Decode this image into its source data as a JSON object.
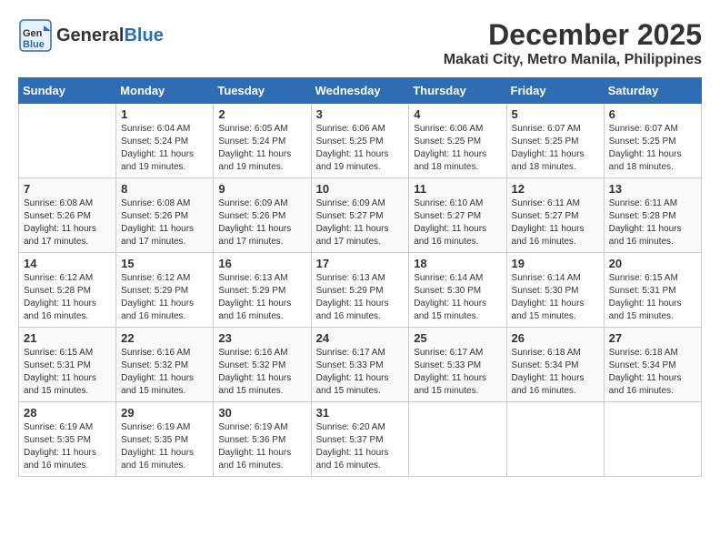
{
  "header": {
    "logo_general": "General",
    "logo_blue": "Blue",
    "month": "December 2025",
    "location": "Makati City, Metro Manila, Philippines"
  },
  "weekdays": [
    "Sunday",
    "Monday",
    "Tuesday",
    "Wednesday",
    "Thursday",
    "Friday",
    "Saturday"
  ],
  "weeks": [
    [
      {
        "day": "",
        "sunrise": "",
        "sunset": "",
        "daylight": ""
      },
      {
        "day": "1",
        "sunrise": "Sunrise: 6:04 AM",
        "sunset": "Sunset: 5:24 PM",
        "daylight": "Daylight: 11 hours and 19 minutes."
      },
      {
        "day": "2",
        "sunrise": "Sunrise: 6:05 AM",
        "sunset": "Sunset: 5:24 PM",
        "daylight": "Daylight: 11 hours and 19 minutes."
      },
      {
        "day": "3",
        "sunrise": "Sunrise: 6:06 AM",
        "sunset": "Sunset: 5:25 PM",
        "daylight": "Daylight: 11 hours and 19 minutes."
      },
      {
        "day": "4",
        "sunrise": "Sunrise: 6:06 AM",
        "sunset": "Sunset: 5:25 PM",
        "daylight": "Daylight: 11 hours and 18 minutes."
      },
      {
        "day": "5",
        "sunrise": "Sunrise: 6:07 AM",
        "sunset": "Sunset: 5:25 PM",
        "daylight": "Daylight: 11 hours and 18 minutes."
      },
      {
        "day": "6",
        "sunrise": "Sunrise: 6:07 AM",
        "sunset": "Sunset: 5:25 PM",
        "daylight": "Daylight: 11 hours and 18 minutes."
      }
    ],
    [
      {
        "day": "7",
        "sunrise": "Sunrise: 6:08 AM",
        "sunset": "Sunset: 5:26 PM",
        "daylight": "Daylight: 11 hours and 17 minutes."
      },
      {
        "day": "8",
        "sunrise": "Sunrise: 6:08 AM",
        "sunset": "Sunset: 5:26 PM",
        "daylight": "Daylight: 11 hours and 17 minutes."
      },
      {
        "day": "9",
        "sunrise": "Sunrise: 6:09 AM",
        "sunset": "Sunset: 5:26 PM",
        "daylight": "Daylight: 11 hours and 17 minutes."
      },
      {
        "day": "10",
        "sunrise": "Sunrise: 6:09 AM",
        "sunset": "Sunset: 5:27 PM",
        "daylight": "Daylight: 11 hours and 17 minutes."
      },
      {
        "day": "11",
        "sunrise": "Sunrise: 6:10 AM",
        "sunset": "Sunset: 5:27 PM",
        "daylight": "Daylight: 11 hours and 16 minutes."
      },
      {
        "day": "12",
        "sunrise": "Sunrise: 6:11 AM",
        "sunset": "Sunset: 5:27 PM",
        "daylight": "Daylight: 11 hours and 16 minutes."
      },
      {
        "day": "13",
        "sunrise": "Sunrise: 6:11 AM",
        "sunset": "Sunset: 5:28 PM",
        "daylight": "Daylight: 11 hours and 16 minutes."
      }
    ],
    [
      {
        "day": "14",
        "sunrise": "Sunrise: 6:12 AM",
        "sunset": "Sunset: 5:28 PM",
        "daylight": "Daylight: 11 hours and 16 minutes."
      },
      {
        "day": "15",
        "sunrise": "Sunrise: 6:12 AM",
        "sunset": "Sunset: 5:29 PM",
        "daylight": "Daylight: 11 hours and 16 minutes."
      },
      {
        "day": "16",
        "sunrise": "Sunrise: 6:13 AM",
        "sunset": "Sunset: 5:29 PM",
        "daylight": "Daylight: 11 hours and 16 minutes."
      },
      {
        "day": "17",
        "sunrise": "Sunrise: 6:13 AM",
        "sunset": "Sunset: 5:29 PM",
        "daylight": "Daylight: 11 hours and 16 minutes."
      },
      {
        "day": "18",
        "sunrise": "Sunrise: 6:14 AM",
        "sunset": "Sunset: 5:30 PM",
        "daylight": "Daylight: 11 hours and 15 minutes."
      },
      {
        "day": "19",
        "sunrise": "Sunrise: 6:14 AM",
        "sunset": "Sunset: 5:30 PM",
        "daylight": "Daylight: 11 hours and 15 minutes."
      },
      {
        "day": "20",
        "sunrise": "Sunrise: 6:15 AM",
        "sunset": "Sunset: 5:31 PM",
        "daylight": "Daylight: 11 hours and 15 minutes."
      }
    ],
    [
      {
        "day": "21",
        "sunrise": "Sunrise: 6:15 AM",
        "sunset": "Sunset: 5:31 PM",
        "daylight": "Daylight: 11 hours and 15 minutes."
      },
      {
        "day": "22",
        "sunrise": "Sunrise: 6:16 AM",
        "sunset": "Sunset: 5:32 PM",
        "daylight": "Daylight: 11 hours and 15 minutes."
      },
      {
        "day": "23",
        "sunrise": "Sunrise: 6:16 AM",
        "sunset": "Sunset: 5:32 PM",
        "daylight": "Daylight: 11 hours and 15 minutes."
      },
      {
        "day": "24",
        "sunrise": "Sunrise: 6:17 AM",
        "sunset": "Sunset: 5:33 PM",
        "daylight": "Daylight: 11 hours and 15 minutes."
      },
      {
        "day": "25",
        "sunrise": "Sunrise: 6:17 AM",
        "sunset": "Sunset: 5:33 PM",
        "daylight": "Daylight: 11 hours and 15 minutes."
      },
      {
        "day": "26",
        "sunrise": "Sunrise: 6:18 AM",
        "sunset": "Sunset: 5:34 PM",
        "daylight": "Daylight: 11 hours and 16 minutes."
      },
      {
        "day": "27",
        "sunrise": "Sunrise: 6:18 AM",
        "sunset": "Sunset: 5:34 PM",
        "daylight": "Daylight: 11 hours and 16 minutes."
      }
    ],
    [
      {
        "day": "28",
        "sunrise": "Sunrise: 6:19 AM",
        "sunset": "Sunset: 5:35 PM",
        "daylight": "Daylight: 11 hours and 16 minutes."
      },
      {
        "day": "29",
        "sunrise": "Sunrise: 6:19 AM",
        "sunset": "Sunset: 5:35 PM",
        "daylight": "Daylight: 11 hours and 16 minutes."
      },
      {
        "day": "30",
        "sunrise": "Sunrise: 6:19 AM",
        "sunset": "Sunset: 5:36 PM",
        "daylight": "Daylight: 11 hours and 16 minutes."
      },
      {
        "day": "31",
        "sunrise": "Sunrise: 6:20 AM",
        "sunset": "Sunset: 5:37 PM",
        "daylight": "Daylight: 11 hours and 16 minutes."
      },
      {
        "day": "",
        "sunrise": "",
        "sunset": "",
        "daylight": ""
      },
      {
        "day": "",
        "sunrise": "",
        "sunset": "",
        "daylight": ""
      },
      {
        "day": "",
        "sunrise": "",
        "sunset": "",
        "daylight": ""
      }
    ]
  ]
}
